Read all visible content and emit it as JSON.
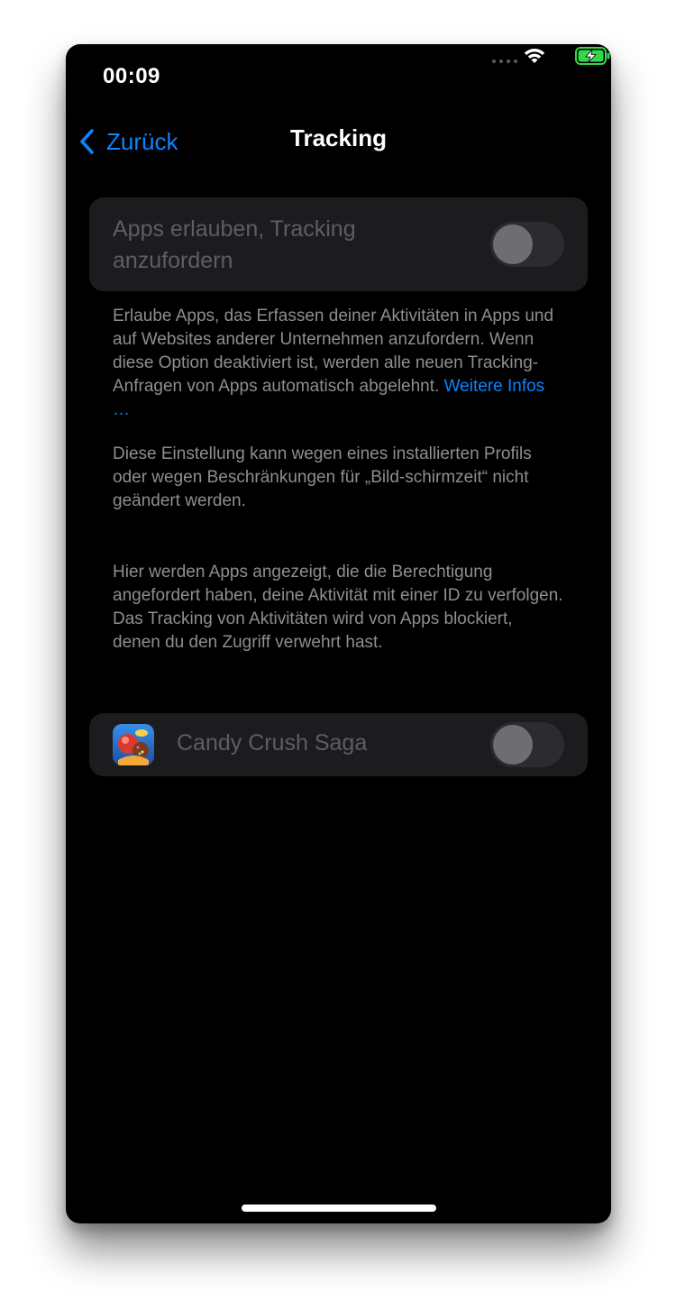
{
  "status_bar": {
    "time": "00:09",
    "signal_icon": "cellular-dots-icon",
    "wifi_icon": "wifi-icon",
    "battery_icon": "battery-charging-icon",
    "battery_color": "#32d74b"
  },
  "nav": {
    "back_label": "Zurück",
    "title": "Tracking",
    "accent_color": "#0a84ff"
  },
  "tracking_setting": {
    "label": "Apps erlauben, Tracking anzufordern",
    "enabled": false,
    "disabled_appearance": true
  },
  "description": {
    "text": "Erlaube Apps, das Erfassen deiner Aktivitäten in Apps und auf Websites anderer Unternehmen anzufordern. Wenn diese Option deaktiviert ist, werden alle neuen Tracking-Anfragen von Apps automatisch abgelehnt.",
    "link": "Weitere Infos …"
  },
  "restriction_note": "Diese Einstellung kann wegen eines installierten Profils oder wegen Beschränkungen für „Bild-schirmzeit“ nicht geändert werden.",
  "apps_info": "Hier werden Apps angezeigt, die die Berechtigung angefordert haben, deine Aktivität mit einer ID zu verfolgen. Das Tracking von Aktivitäten wird von Apps blockiert, denen du den Zugriff verwehrt hast.",
  "apps": [
    {
      "name": "Candy Crush Saga",
      "icon": "candy-crush-app-icon",
      "enabled": false
    }
  ]
}
